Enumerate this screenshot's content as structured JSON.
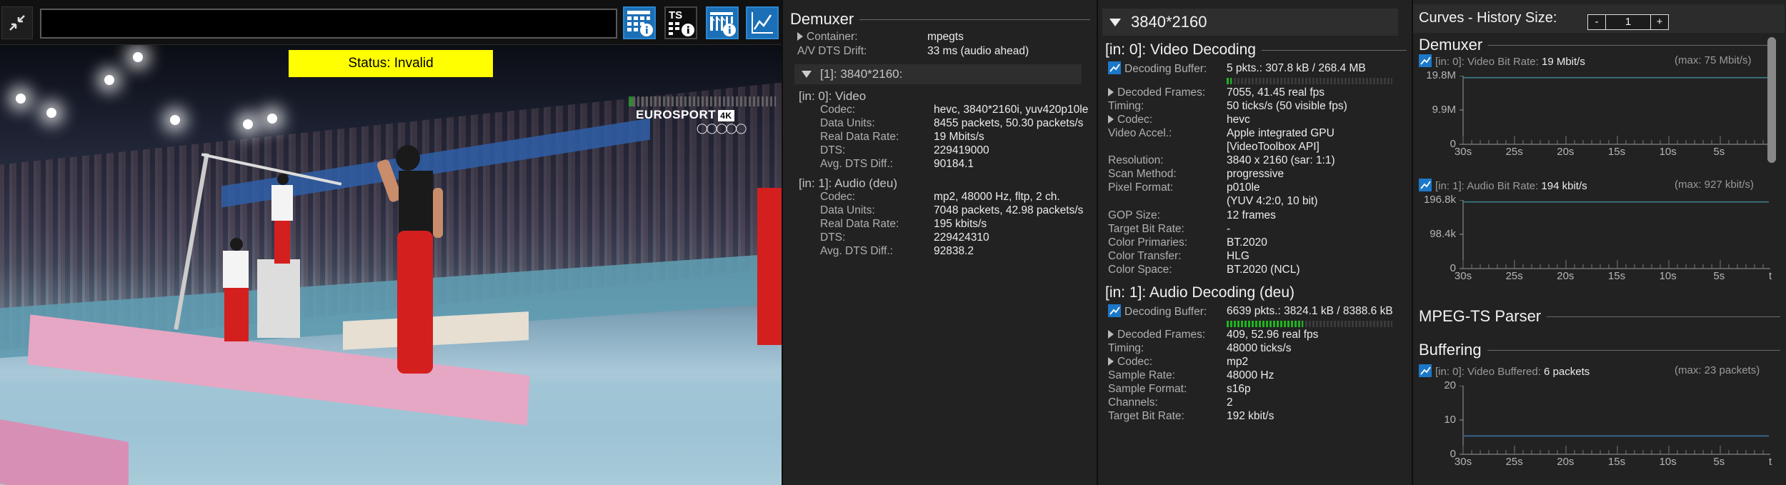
{
  "toolbar": {
    "url_value": "",
    "ts_label": "TS"
  },
  "video": {
    "status": "Status: Invalid",
    "broadcaster_logo": "EUROSPORT",
    "broadcaster_logo_badge": "4K"
  },
  "demuxer_panel": {
    "title": "Demuxer",
    "container_label": "Container:",
    "container_value": "mpegts",
    "dts_drift_label": "A/V DTS Drift:",
    "dts_drift_value": "33 ms (audio ahead)",
    "program_label": "[1]: 3840*2160:",
    "video_stream": {
      "header": "[in: 0]: Video",
      "rows": [
        {
          "k": "Codec:",
          "v": "hevc, 3840*2160i, yuv420p10le"
        },
        {
          "k": "Data Units:",
          "v": "8455 packets, 50.30 packets/s"
        },
        {
          "k": "Real Data Rate:",
          "v": "19 Mbits/s"
        },
        {
          "k": "DTS:",
          "v": "229419000"
        },
        {
          "k": "Avg. DTS Diff.:",
          "v": "90184.1"
        }
      ]
    },
    "audio_stream": {
      "header": "[in: 1]: Audio (deu)",
      "rows": [
        {
          "k": "Codec:",
          "v": "mp2, 48000 Hz, fltp, 2 ch."
        },
        {
          "k": "Data Units:",
          "v": "7048 packets, 42.98 packets/s"
        },
        {
          "k": "Real Data Rate:",
          "v": "195 kbits/s"
        },
        {
          "k": "DTS:",
          "v": "229424310"
        },
        {
          "k": "Avg. DTS Diff.:",
          "v": "92838.2"
        }
      ]
    }
  },
  "decoding_panel": {
    "title": "3840*2160",
    "video": {
      "header": "[in: 0]: Video Decoding",
      "buffer_label": "Decoding Buffer:",
      "buffer_value": "5 pkts.: 307.8 kB / 268.4 MB",
      "buffer_fill": 0.03,
      "decoded_label": "Decoded Frames:",
      "decoded_value": "7055, 41.45 real fps",
      "timing_label": "Timing:",
      "timing_value": "50 ticks/s (50 visible fps)",
      "codec_label": "Codec:",
      "codec_value": "hevc",
      "accel_label": "Video Accel.:",
      "accel_value1": "Apple integrated GPU",
      "accel_value2": "[VideoToolbox API]",
      "resolution_label": "Resolution:",
      "resolution_value": "3840 x 2160 (sar: 1:1)",
      "scan_label": "Scan Method:",
      "scan_value": "progressive",
      "pixfmt_label": "Pixel Format:",
      "pixfmt_value1": "p010le",
      "pixfmt_value2": "(YUV 4:2:0, 10 bit)",
      "gop_label": "GOP Size:",
      "gop_value": "12 frames",
      "target_label": "Target Bit Rate:",
      "target_value": "-",
      "primaries_label": "Color Primaries:",
      "primaries_value": "BT.2020",
      "transfer_label": "Color Transfer:",
      "transfer_value": "HLG",
      "space_label": "Color Space:",
      "space_value": "BT.2020 (NCL)"
    },
    "audio": {
      "header": "[in: 1]: Audio Decoding (deu)",
      "buffer_label": "Decoding Buffer:",
      "buffer_value": "6639 pkts.: 3824.1 kB / 8388.6 kB",
      "buffer_fill": 0.46,
      "decoded_label": "Decoded Frames:",
      "decoded_value": "409, 52.96 real fps",
      "timing_label": "Timing:",
      "timing_value": "48000 ticks/s",
      "codec_label": "Codec:",
      "codec_value": "mp2",
      "rate_label": "Sample Rate:",
      "rate_value": "48000 Hz",
      "fmt_label": "Sample Format:",
      "fmt_value": "s16p",
      "ch_label": "Channels:",
      "ch_value": "2",
      "target_label": "Target Bit Rate:",
      "target_value": "192 kbit/s"
    }
  },
  "curves_panel": {
    "title": "Curves - History Size:",
    "spin_minus": "-",
    "spin_value": "1",
    "spin_plus": "+",
    "demuxer_title": "Demuxer",
    "parser_title": "MPEG-TS Parser",
    "buffering_title": "Buffering",
    "x_ticks": [
      "30s",
      "25s",
      "20s",
      "15s",
      "10s",
      "5s",
      "t"
    ],
    "charts": [
      {
        "label": "[in: 0]: Video Bit Rate:",
        "value": "19 Mbit/s",
        "max": "(max: 75 Mbit/s)",
        "y_ticks": [
          "19.8M",
          "9.9M",
          "0"
        ]
      },
      {
        "label": "[in: 1]: Audio Bit Rate:",
        "value": "194 kbit/s",
        "max": "(max: 927 kbit/s)",
        "y_ticks": [
          "196.8k",
          "98.4k",
          "0"
        ]
      },
      {
        "label": "[in: 0]: Video Buffered:",
        "value": "6 packets",
        "max": "(max: 23 packets)",
        "y_ticks": [
          "20",
          "10",
          "0"
        ]
      }
    ]
  }
}
